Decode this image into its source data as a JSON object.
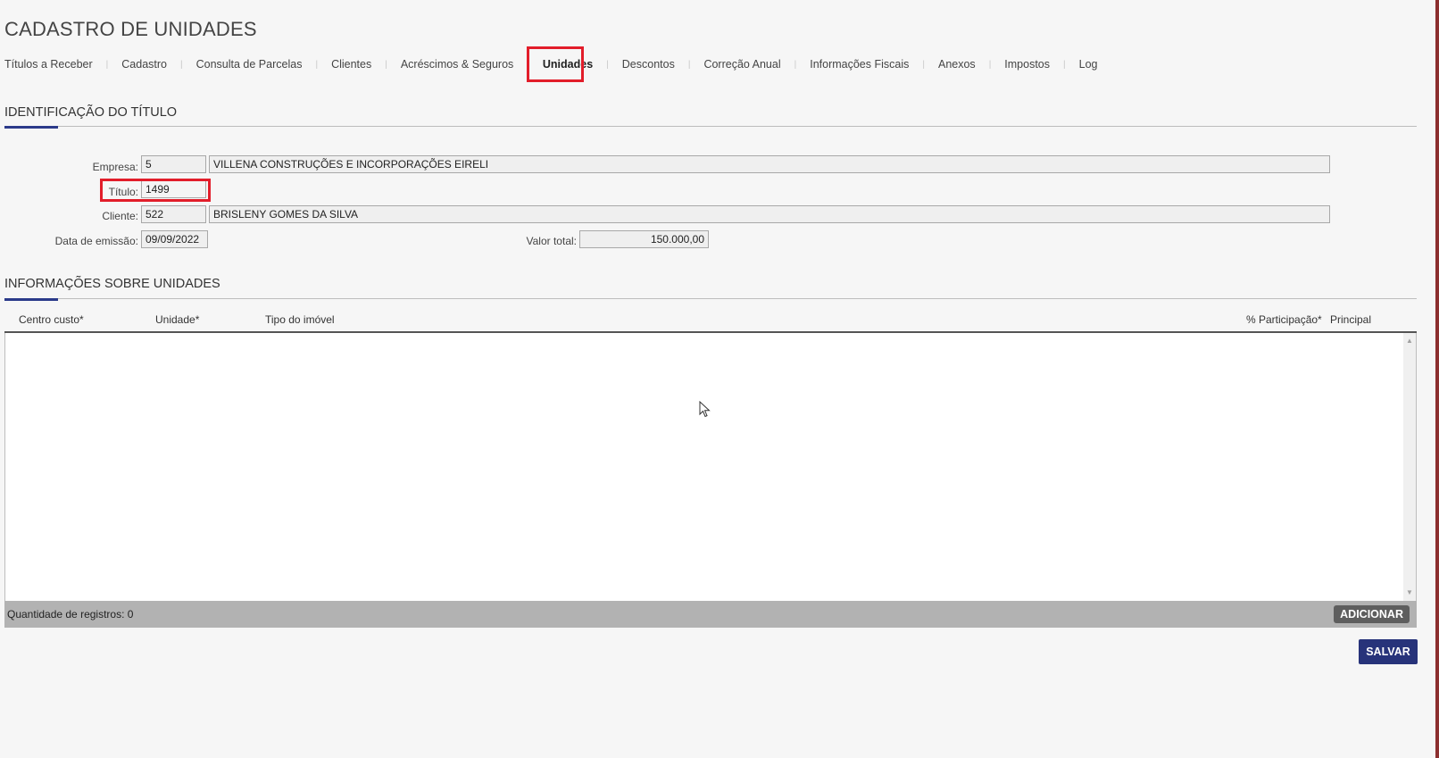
{
  "page": {
    "title": "CADASTRO DE UNIDADES"
  },
  "tabs": [
    {
      "label": "Títulos a Receber"
    },
    {
      "label": "Cadastro"
    },
    {
      "label": "Consulta de Parcelas"
    },
    {
      "label": "Clientes"
    },
    {
      "label": "Acréscimos & Seguros"
    },
    {
      "label": "Unidades",
      "active": true
    },
    {
      "label": "Descontos"
    },
    {
      "label": "Correção Anual"
    },
    {
      "label": "Informações Fiscais"
    },
    {
      "label": "Anexos"
    },
    {
      "label": "Impostos"
    },
    {
      "label": "Log"
    }
  ],
  "identificacao": {
    "title": "IDENTIFICAÇÃO DO TÍTULO",
    "empresa": {
      "label": "Empresa:",
      "code": "5",
      "name": "VILLENA CONSTRUÇÕES E INCORPORAÇÕES EIRELI"
    },
    "titulo": {
      "label": "Título:",
      "value": "1499"
    },
    "cliente": {
      "label": "Cliente:",
      "code": "522",
      "name": "BRISLENY GOMES DA SILVA"
    },
    "data_emissao": {
      "label": "Data de emissão:",
      "value": "09/09/2022"
    },
    "valor_total": {
      "label": "Valor total:",
      "value": "150.000,00"
    }
  },
  "unidades": {
    "title": "INFORMAÇÕES SOBRE UNIDADES",
    "columns": [
      "Centro custo*",
      "Unidade*",
      "Tipo do imóvel",
      "% Participação*",
      "Principal"
    ],
    "rows": [],
    "records_label": "Quantidade de registros: 0",
    "add_label": "ADICIONAR"
  },
  "actions": {
    "save_label": "SALVAR"
  },
  "colors": {
    "accent": "#2b3a8a",
    "highlight": "#e21d2a",
    "save_button": "#27337a"
  }
}
